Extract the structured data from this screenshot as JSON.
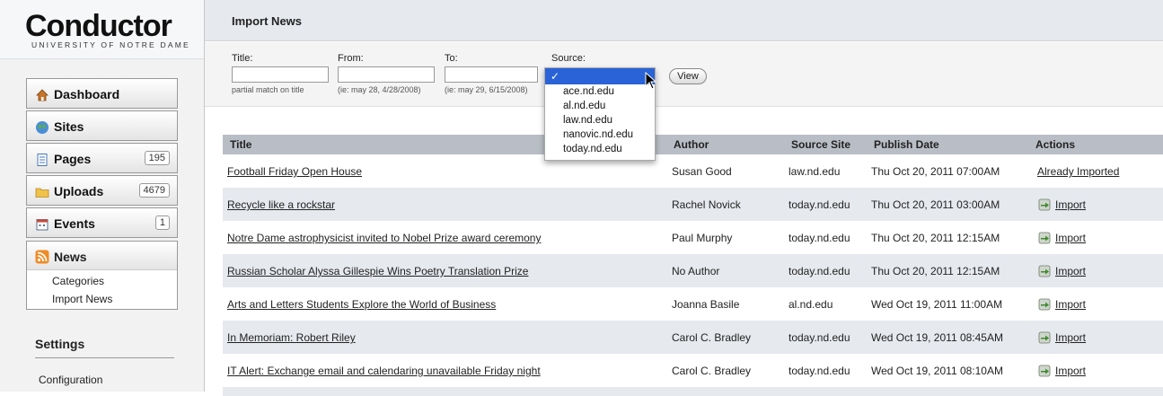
{
  "brand": {
    "name": "Conductor",
    "sub": "UNIVERSITY OF NOTRE DAME"
  },
  "nav": {
    "dashboard": "Dashboard",
    "sites": "Sites",
    "pages": "Pages",
    "pages_count": "195",
    "uploads": "Uploads",
    "uploads_count": "4679",
    "events": "Events",
    "events_count": "1",
    "news": "News",
    "categories": "Categories",
    "import_news": "Import News",
    "settings": "Settings",
    "configuration": "Configuration"
  },
  "page": {
    "title": "Import News"
  },
  "filters": {
    "title_label": "Title:",
    "title_hint": "partial match on title",
    "from_label": "From:",
    "from_hint": "(ie: may 28, 4/28/2008)",
    "to_label": "To:",
    "to_hint": "(ie: may 29, 6/15/2008)",
    "source_label": "Source:",
    "view": "View",
    "source_selected": "✓",
    "source_options": [
      "ace.nd.edu",
      "al.nd.edu",
      "law.nd.edu",
      "nanovic.nd.edu",
      "today.nd.edu"
    ]
  },
  "table": {
    "headers": {
      "title": "Title",
      "author": "Author",
      "source": "Source Site",
      "date": "Publish Date",
      "actions": "Actions"
    },
    "rows": [
      {
        "title": "Football Friday Open House",
        "author": "Susan Good",
        "source": "law.nd.edu",
        "date": "Thu Oct 20, 2011 07:00AM",
        "action": "Already Imported"
      },
      {
        "title": "Recycle like a rockstar",
        "author": "Rachel Novick",
        "source": "today.nd.edu",
        "date": "Thu Oct 20, 2011 03:00AM",
        "action": "Import"
      },
      {
        "title": "Notre Dame astrophysicist invited to Nobel Prize award ceremony",
        "author": "Paul Murphy",
        "source": "today.nd.edu",
        "date": "Thu Oct 20, 2011 12:15AM",
        "action": "Import"
      },
      {
        "title": "Russian Scholar Alyssa Gillespie Wins Poetry Translation Prize",
        "author": "No Author",
        "source": "today.nd.edu",
        "date": "Thu Oct 20, 2011 12:15AM",
        "action": "Import"
      },
      {
        "title": "Arts and Letters Students Explore the World of Business",
        "author": "Joanna Basile",
        "source": "al.nd.edu",
        "date": "Wed Oct 19, 2011 11:00AM",
        "action": "Import"
      },
      {
        "title": "In Memoriam: Robert Riley",
        "author": "Carol C. Bradley",
        "source": "today.nd.edu",
        "date": "Wed Oct 19, 2011 08:45AM",
        "action": "Import"
      },
      {
        "title": "IT Alert: Exchange email and calendaring unavailable Friday night",
        "author": "Carol C. Bradley",
        "source": "today.nd.edu",
        "date": "Wed Oct 19, 2011 08:10AM",
        "action": "Import"
      }
    ]
  }
}
